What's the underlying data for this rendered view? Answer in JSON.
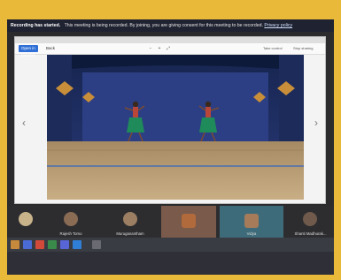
{
  "banner": {
    "title": "Recording has started.",
    "message": "This meeting is being recorded. By joining, you are giving consent for this meeting to be recorded.",
    "link": "Privacy policy"
  },
  "toolbar": {
    "primary_label": "Open in browser",
    "back_label": "Back",
    "right_labels": [
      "Take control",
      "Stop sharing"
    ]
  },
  "participants": [
    {
      "name": "Rajesh Tomo",
      "avatar_color": "#c9b38a"
    },
    {
      "name": "Muruganantham",
      "avatar_color": "#8a6c55"
    },
    {
      "name": "",
      "avatar_color": "#9c7f63"
    },
    {
      "name": "",
      "avatar_color": "#b16a3c"
    },
    {
      "name": "Vidya",
      "avatar_color": "#a57b5a"
    },
    {
      "name": "Shanti Madhurak...",
      "avatar_color": "#6f5a4b"
    }
  ],
  "icons": {
    "prev": "‹",
    "next": "›"
  }
}
